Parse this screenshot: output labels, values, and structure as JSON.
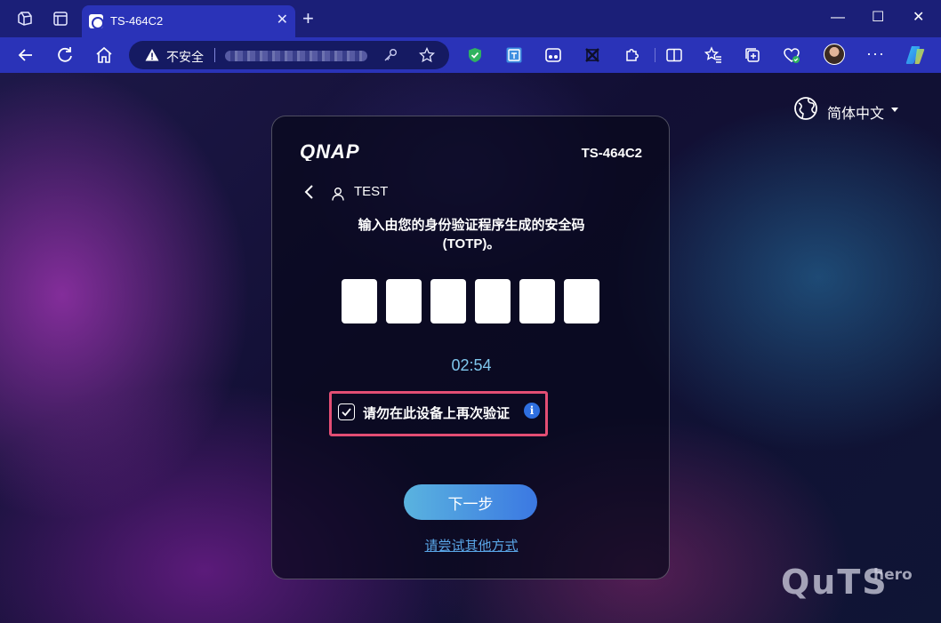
{
  "browser": {
    "tab_title": "TS-464C2",
    "tab_close": "✕",
    "new_tab": "+",
    "win_min": "—",
    "win_max": "☐",
    "win_close": "✕",
    "security_label": "不安全",
    "more": "···",
    "colors": {
      "titlebar": "#1b1f78",
      "toolbar": "#2a33b8"
    }
  },
  "page": {
    "language": "简体中文",
    "brand_main": "QuTS",
    "brand_sub": "hero"
  },
  "login": {
    "logo_text": "QNAP",
    "model": "TS-464C2",
    "username": "TEST",
    "instruction_line1": "输入由您的身份验证程序生成的安全码",
    "instruction_line2": "(TOTP)。",
    "code_digits": [
      "",
      "",
      "",
      "",
      "",
      ""
    ],
    "timer": "02:54",
    "remember_label": "请勿在此设备上再次验证",
    "remember_checked": true,
    "info_glyph": "i",
    "next_button": "下一步",
    "alt_link": "请尝试其他方式",
    "colors": {
      "accent": "#3b78e2",
      "timer": "#7fc6ec",
      "highlight": "#e34e74",
      "link": "#5aa7e8"
    }
  }
}
